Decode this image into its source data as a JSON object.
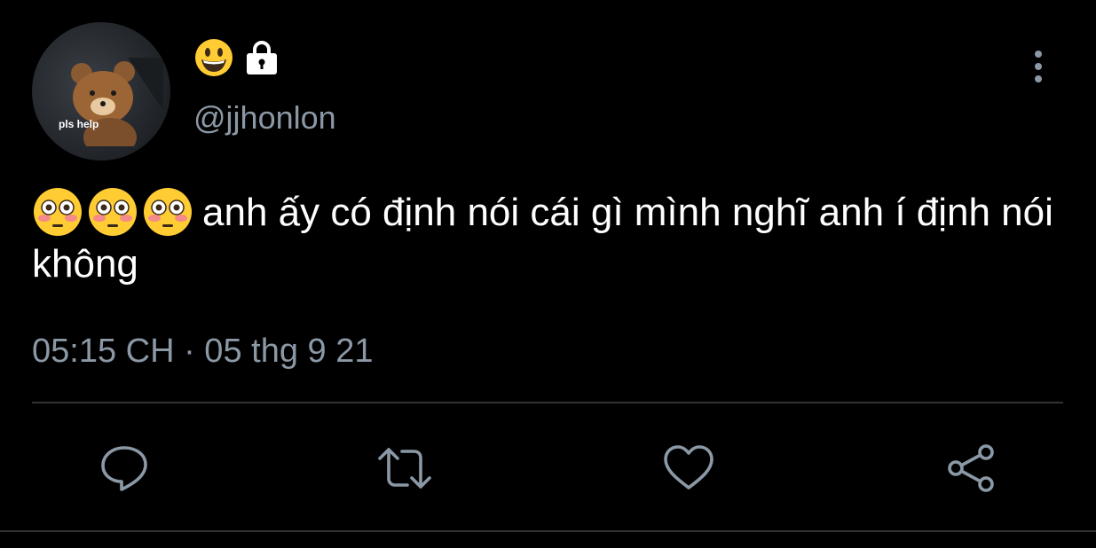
{
  "profile": {
    "avatar_caption": "pls help",
    "display_name_emoji": "😀",
    "protected_icon": "lock-icon",
    "handle": "@jjhonlon"
  },
  "tweet": {
    "leading_emojis": [
      "😳",
      "😳",
      "😳"
    ],
    "text": "anh ấy có định nói cái gì mình nghĩ anh í định nói không",
    "timestamp": "05:15 CH · 05 thg 9 21"
  },
  "actions": [
    {
      "name": "reply",
      "icon": "comment-icon"
    },
    {
      "name": "retweet",
      "icon": "retweet-icon"
    },
    {
      "name": "like",
      "icon": "heart-icon"
    },
    {
      "name": "share",
      "icon": "share-icon"
    }
  ],
  "colors": {
    "background": "#000000",
    "primary_text": "#ffffff",
    "secondary_text": "#8b98a5",
    "divider": "#2f3336",
    "icon": "#8b98a5"
  }
}
